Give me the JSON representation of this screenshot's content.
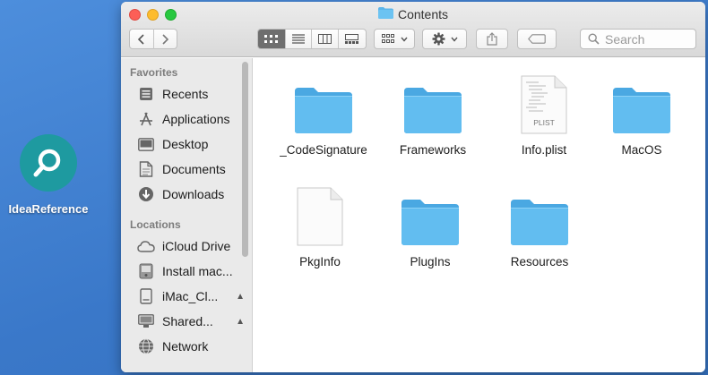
{
  "desktop": {
    "icon_label": "IdeaReference"
  },
  "window": {
    "title": "Contents"
  },
  "toolbar": {
    "search_placeholder": "Search"
  },
  "sidebar": {
    "favorites_title": "Favorites",
    "favorites": [
      {
        "label": "Recents",
        "icon": "recents-icon"
      },
      {
        "label": "Applications",
        "icon": "applications-icon"
      },
      {
        "label": "Desktop",
        "icon": "desktop-icon"
      },
      {
        "label": "Documents",
        "icon": "documents-icon"
      },
      {
        "label": "Downloads",
        "icon": "downloads-icon"
      }
    ],
    "locations_title": "Locations",
    "locations": [
      {
        "label": "iCloud Drive",
        "icon": "cloud-icon"
      },
      {
        "label": "Install mac...",
        "icon": "disk-image-icon"
      },
      {
        "label": "iMac_Cl...",
        "icon": "drive-icon",
        "eject": true
      },
      {
        "label": "Shared...",
        "icon": "display-icon",
        "eject": true
      },
      {
        "label": "Network",
        "icon": "network-icon"
      }
    ]
  },
  "files": [
    {
      "name": "_CodeSignature",
      "type": "folder"
    },
    {
      "name": "Frameworks",
      "type": "folder"
    },
    {
      "name": "Info.plist",
      "type": "plist",
      "badge": "PLIST"
    },
    {
      "name": "MacOS",
      "type": "folder"
    },
    {
      "name": "PkgInfo",
      "type": "document"
    },
    {
      "name": "PlugIns",
      "type": "folder"
    },
    {
      "name": "Resources",
      "type": "folder"
    }
  ],
  "colors": {
    "folder": "#5bbcf0",
    "desktop_bg": "#3f7fd0",
    "accent_icon": "#1e9aa0"
  }
}
